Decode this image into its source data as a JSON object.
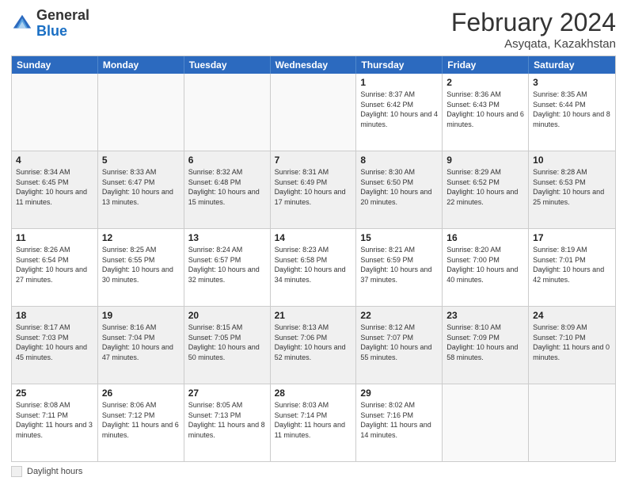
{
  "header": {
    "logo": {
      "general": "General",
      "blue": "Blue"
    },
    "title": "February 2024",
    "location": "Asyqata, Kazakhstan"
  },
  "weekdays": [
    "Sunday",
    "Monday",
    "Tuesday",
    "Wednesday",
    "Thursday",
    "Friday",
    "Saturday"
  ],
  "rows": [
    [
      {
        "day": "",
        "text": "",
        "empty": true
      },
      {
        "day": "",
        "text": "",
        "empty": true
      },
      {
        "day": "",
        "text": "",
        "empty": true
      },
      {
        "day": "",
        "text": "",
        "empty": true
      },
      {
        "day": "1",
        "text": "Sunrise: 8:37 AM\nSunset: 6:42 PM\nDaylight: 10 hours\nand 4 minutes."
      },
      {
        "day": "2",
        "text": "Sunrise: 8:36 AM\nSunset: 6:43 PM\nDaylight: 10 hours\nand 6 minutes."
      },
      {
        "day": "3",
        "text": "Sunrise: 8:35 AM\nSunset: 6:44 PM\nDaylight: 10 hours\nand 8 minutes."
      }
    ],
    [
      {
        "day": "4",
        "text": "Sunrise: 8:34 AM\nSunset: 6:45 PM\nDaylight: 10 hours\nand 11 minutes.",
        "shaded": true
      },
      {
        "day": "5",
        "text": "Sunrise: 8:33 AM\nSunset: 6:47 PM\nDaylight: 10 hours\nand 13 minutes.",
        "shaded": true
      },
      {
        "day": "6",
        "text": "Sunrise: 8:32 AM\nSunset: 6:48 PM\nDaylight: 10 hours\nand 15 minutes.",
        "shaded": true
      },
      {
        "day": "7",
        "text": "Sunrise: 8:31 AM\nSunset: 6:49 PM\nDaylight: 10 hours\nand 17 minutes.",
        "shaded": true
      },
      {
        "day": "8",
        "text": "Sunrise: 8:30 AM\nSunset: 6:50 PM\nDaylight: 10 hours\nand 20 minutes.",
        "shaded": true
      },
      {
        "day": "9",
        "text": "Sunrise: 8:29 AM\nSunset: 6:52 PM\nDaylight: 10 hours\nand 22 minutes.",
        "shaded": true
      },
      {
        "day": "10",
        "text": "Sunrise: 8:28 AM\nSunset: 6:53 PM\nDaylight: 10 hours\nand 25 minutes.",
        "shaded": true
      }
    ],
    [
      {
        "day": "11",
        "text": "Sunrise: 8:26 AM\nSunset: 6:54 PM\nDaylight: 10 hours\nand 27 minutes."
      },
      {
        "day": "12",
        "text": "Sunrise: 8:25 AM\nSunset: 6:55 PM\nDaylight: 10 hours\nand 30 minutes."
      },
      {
        "day": "13",
        "text": "Sunrise: 8:24 AM\nSunset: 6:57 PM\nDaylight: 10 hours\nand 32 minutes."
      },
      {
        "day": "14",
        "text": "Sunrise: 8:23 AM\nSunset: 6:58 PM\nDaylight: 10 hours\nand 34 minutes."
      },
      {
        "day": "15",
        "text": "Sunrise: 8:21 AM\nSunset: 6:59 PM\nDaylight: 10 hours\nand 37 minutes."
      },
      {
        "day": "16",
        "text": "Sunrise: 8:20 AM\nSunset: 7:00 PM\nDaylight: 10 hours\nand 40 minutes."
      },
      {
        "day": "17",
        "text": "Sunrise: 8:19 AM\nSunset: 7:01 PM\nDaylight: 10 hours\nand 42 minutes."
      }
    ],
    [
      {
        "day": "18",
        "text": "Sunrise: 8:17 AM\nSunset: 7:03 PM\nDaylight: 10 hours\nand 45 minutes.",
        "shaded": true
      },
      {
        "day": "19",
        "text": "Sunrise: 8:16 AM\nSunset: 7:04 PM\nDaylight: 10 hours\nand 47 minutes.",
        "shaded": true
      },
      {
        "day": "20",
        "text": "Sunrise: 8:15 AM\nSunset: 7:05 PM\nDaylight: 10 hours\nand 50 minutes.",
        "shaded": true
      },
      {
        "day": "21",
        "text": "Sunrise: 8:13 AM\nSunset: 7:06 PM\nDaylight: 10 hours\nand 52 minutes.",
        "shaded": true
      },
      {
        "day": "22",
        "text": "Sunrise: 8:12 AM\nSunset: 7:07 PM\nDaylight: 10 hours\nand 55 minutes.",
        "shaded": true
      },
      {
        "day": "23",
        "text": "Sunrise: 8:10 AM\nSunset: 7:09 PM\nDaylight: 10 hours\nand 58 minutes.",
        "shaded": true
      },
      {
        "day": "24",
        "text": "Sunrise: 8:09 AM\nSunset: 7:10 PM\nDaylight: 11 hours\nand 0 minutes.",
        "shaded": true
      }
    ],
    [
      {
        "day": "25",
        "text": "Sunrise: 8:08 AM\nSunset: 7:11 PM\nDaylight: 11 hours\nand 3 minutes."
      },
      {
        "day": "26",
        "text": "Sunrise: 8:06 AM\nSunset: 7:12 PM\nDaylight: 11 hours\nand 6 minutes."
      },
      {
        "day": "27",
        "text": "Sunrise: 8:05 AM\nSunset: 7:13 PM\nDaylight: 11 hours\nand 8 minutes."
      },
      {
        "day": "28",
        "text": "Sunrise: 8:03 AM\nSunset: 7:14 PM\nDaylight: 11 hours\nand 11 minutes."
      },
      {
        "day": "29",
        "text": "Sunrise: 8:02 AM\nSunset: 7:16 PM\nDaylight: 11 hours\nand 14 minutes."
      },
      {
        "day": "",
        "text": "",
        "empty": true
      },
      {
        "day": "",
        "text": "",
        "empty": true
      }
    ]
  ],
  "legend": {
    "box_label": "",
    "text": "Daylight hours"
  }
}
